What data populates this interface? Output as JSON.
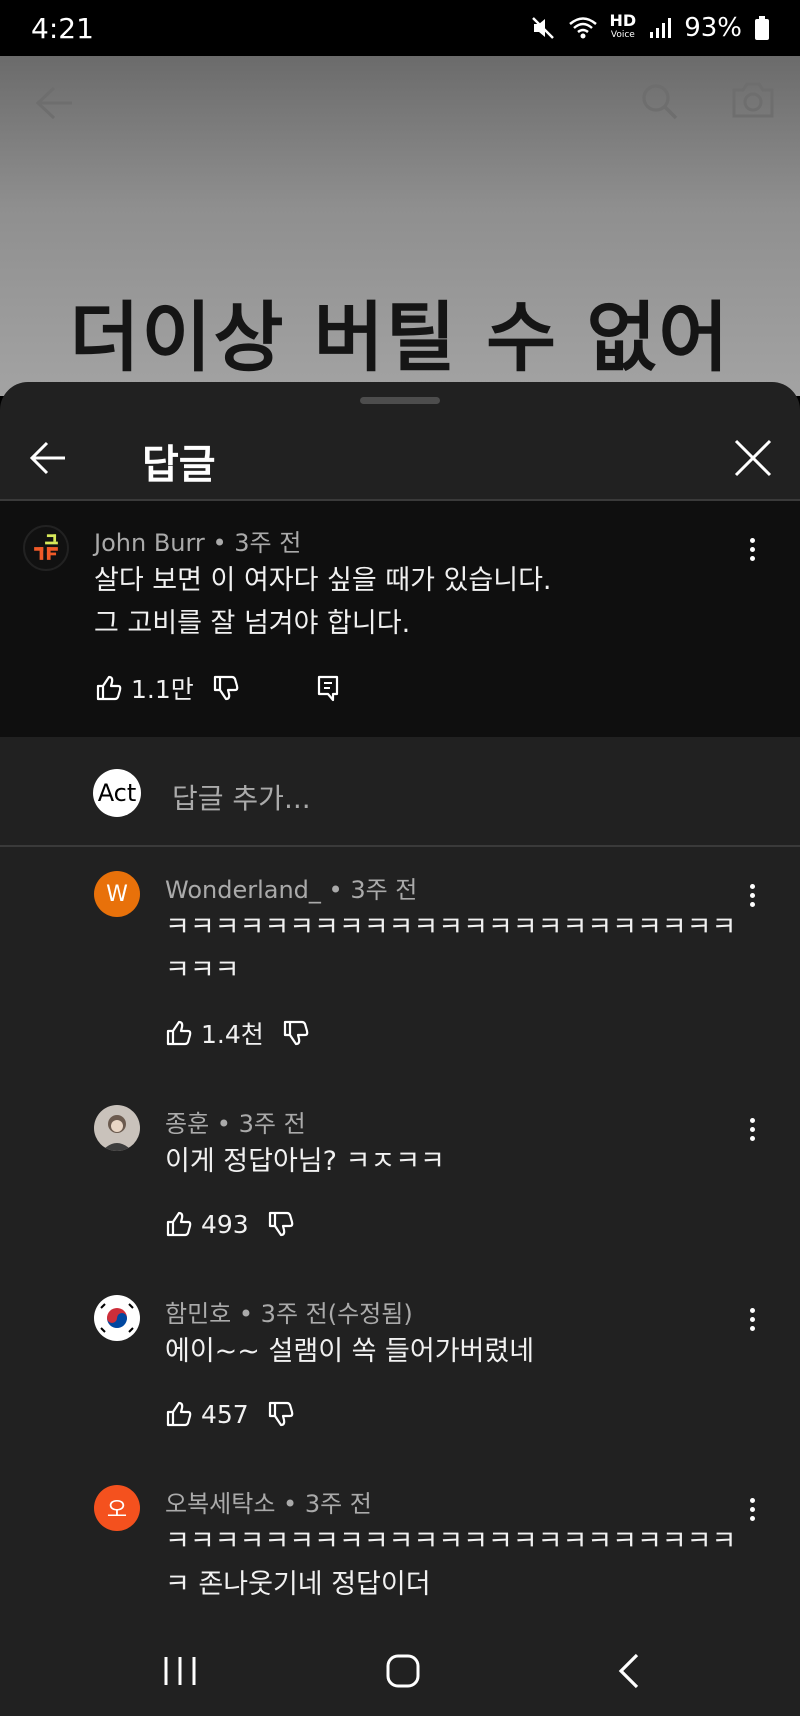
{
  "status_bar": {
    "time": "4:21",
    "battery": "93%",
    "hd_label": "HD",
    "voice_label": "Voice"
  },
  "video": {
    "caption": "더이상 버틸 수 없어"
  },
  "panel": {
    "title": "답글"
  },
  "parent_comment": {
    "author": "John Burr",
    "age": "3주 전",
    "lines": [
      "살다 보면 이 여자다 싶을 때가 있습니다.",
      "그 고비를 잘 넘겨야 합니다."
    ],
    "likes": "1.1만",
    "avatar_text": "ㄱㅌ"
  },
  "add_reply": {
    "avatar_label": "Act",
    "placeholder": "답글 추가..."
  },
  "replies": [
    {
      "author": "Wonderland_",
      "age": "3주 전",
      "lines": [
        "ㅋㅋㅋㅋㅋㅋㅋㅋㅋㅋㅋㅋㅋㅋㅋㅋㅋㅋㅋㅋㅋㅋㅋ",
        "ㅋㅋㅋ"
      ],
      "likes": "1.4천",
      "avatar_initial": "W",
      "avatar_color": "#e8710a"
    },
    {
      "author": "종훈",
      "age": "3주 전",
      "lines": [
        "이게 정답아님? ㅋㅈㅋㅋ"
      ],
      "likes": "493",
      "avatar_initial": "",
      "avatar_color": "#c9c2bb"
    },
    {
      "author": "함민호",
      "age": "3주 전(수정됨)",
      "lines": [
        "에이~~ 설램이 쏙 들어가버렸네"
      ],
      "likes": "457",
      "avatar_initial": "",
      "avatar_color": "#ffffff"
    },
    {
      "author": "오복세탁소",
      "age": "3주 전",
      "lines": [
        "ㅋㅋㅋㅋㅋㅋㅋㅋㅋㅋㅋㅋㅋㅋㅋㅋㅋㅋㅋㅋㅋㅋㅋ",
        "ㅋ 존나웃기네 정답이더"
      ],
      "likes": "",
      "avatar_initial": "오",
      "avatar_color": "#f4511e"
    }
  ],
  "colors": {
    "sheet_bg": "#212121",
    "parent_bg": "#0f0f0f",
    "meta_text": "#aaaaaa"
  },
  "icons": [
    "back-arrow-icon",
    "search-icon",
    "camera-icon",
    "close-icon",
    "like-icon",
    "dislike-icon",
    "reply-icon",
    "more-options-icon"
  ]
}
